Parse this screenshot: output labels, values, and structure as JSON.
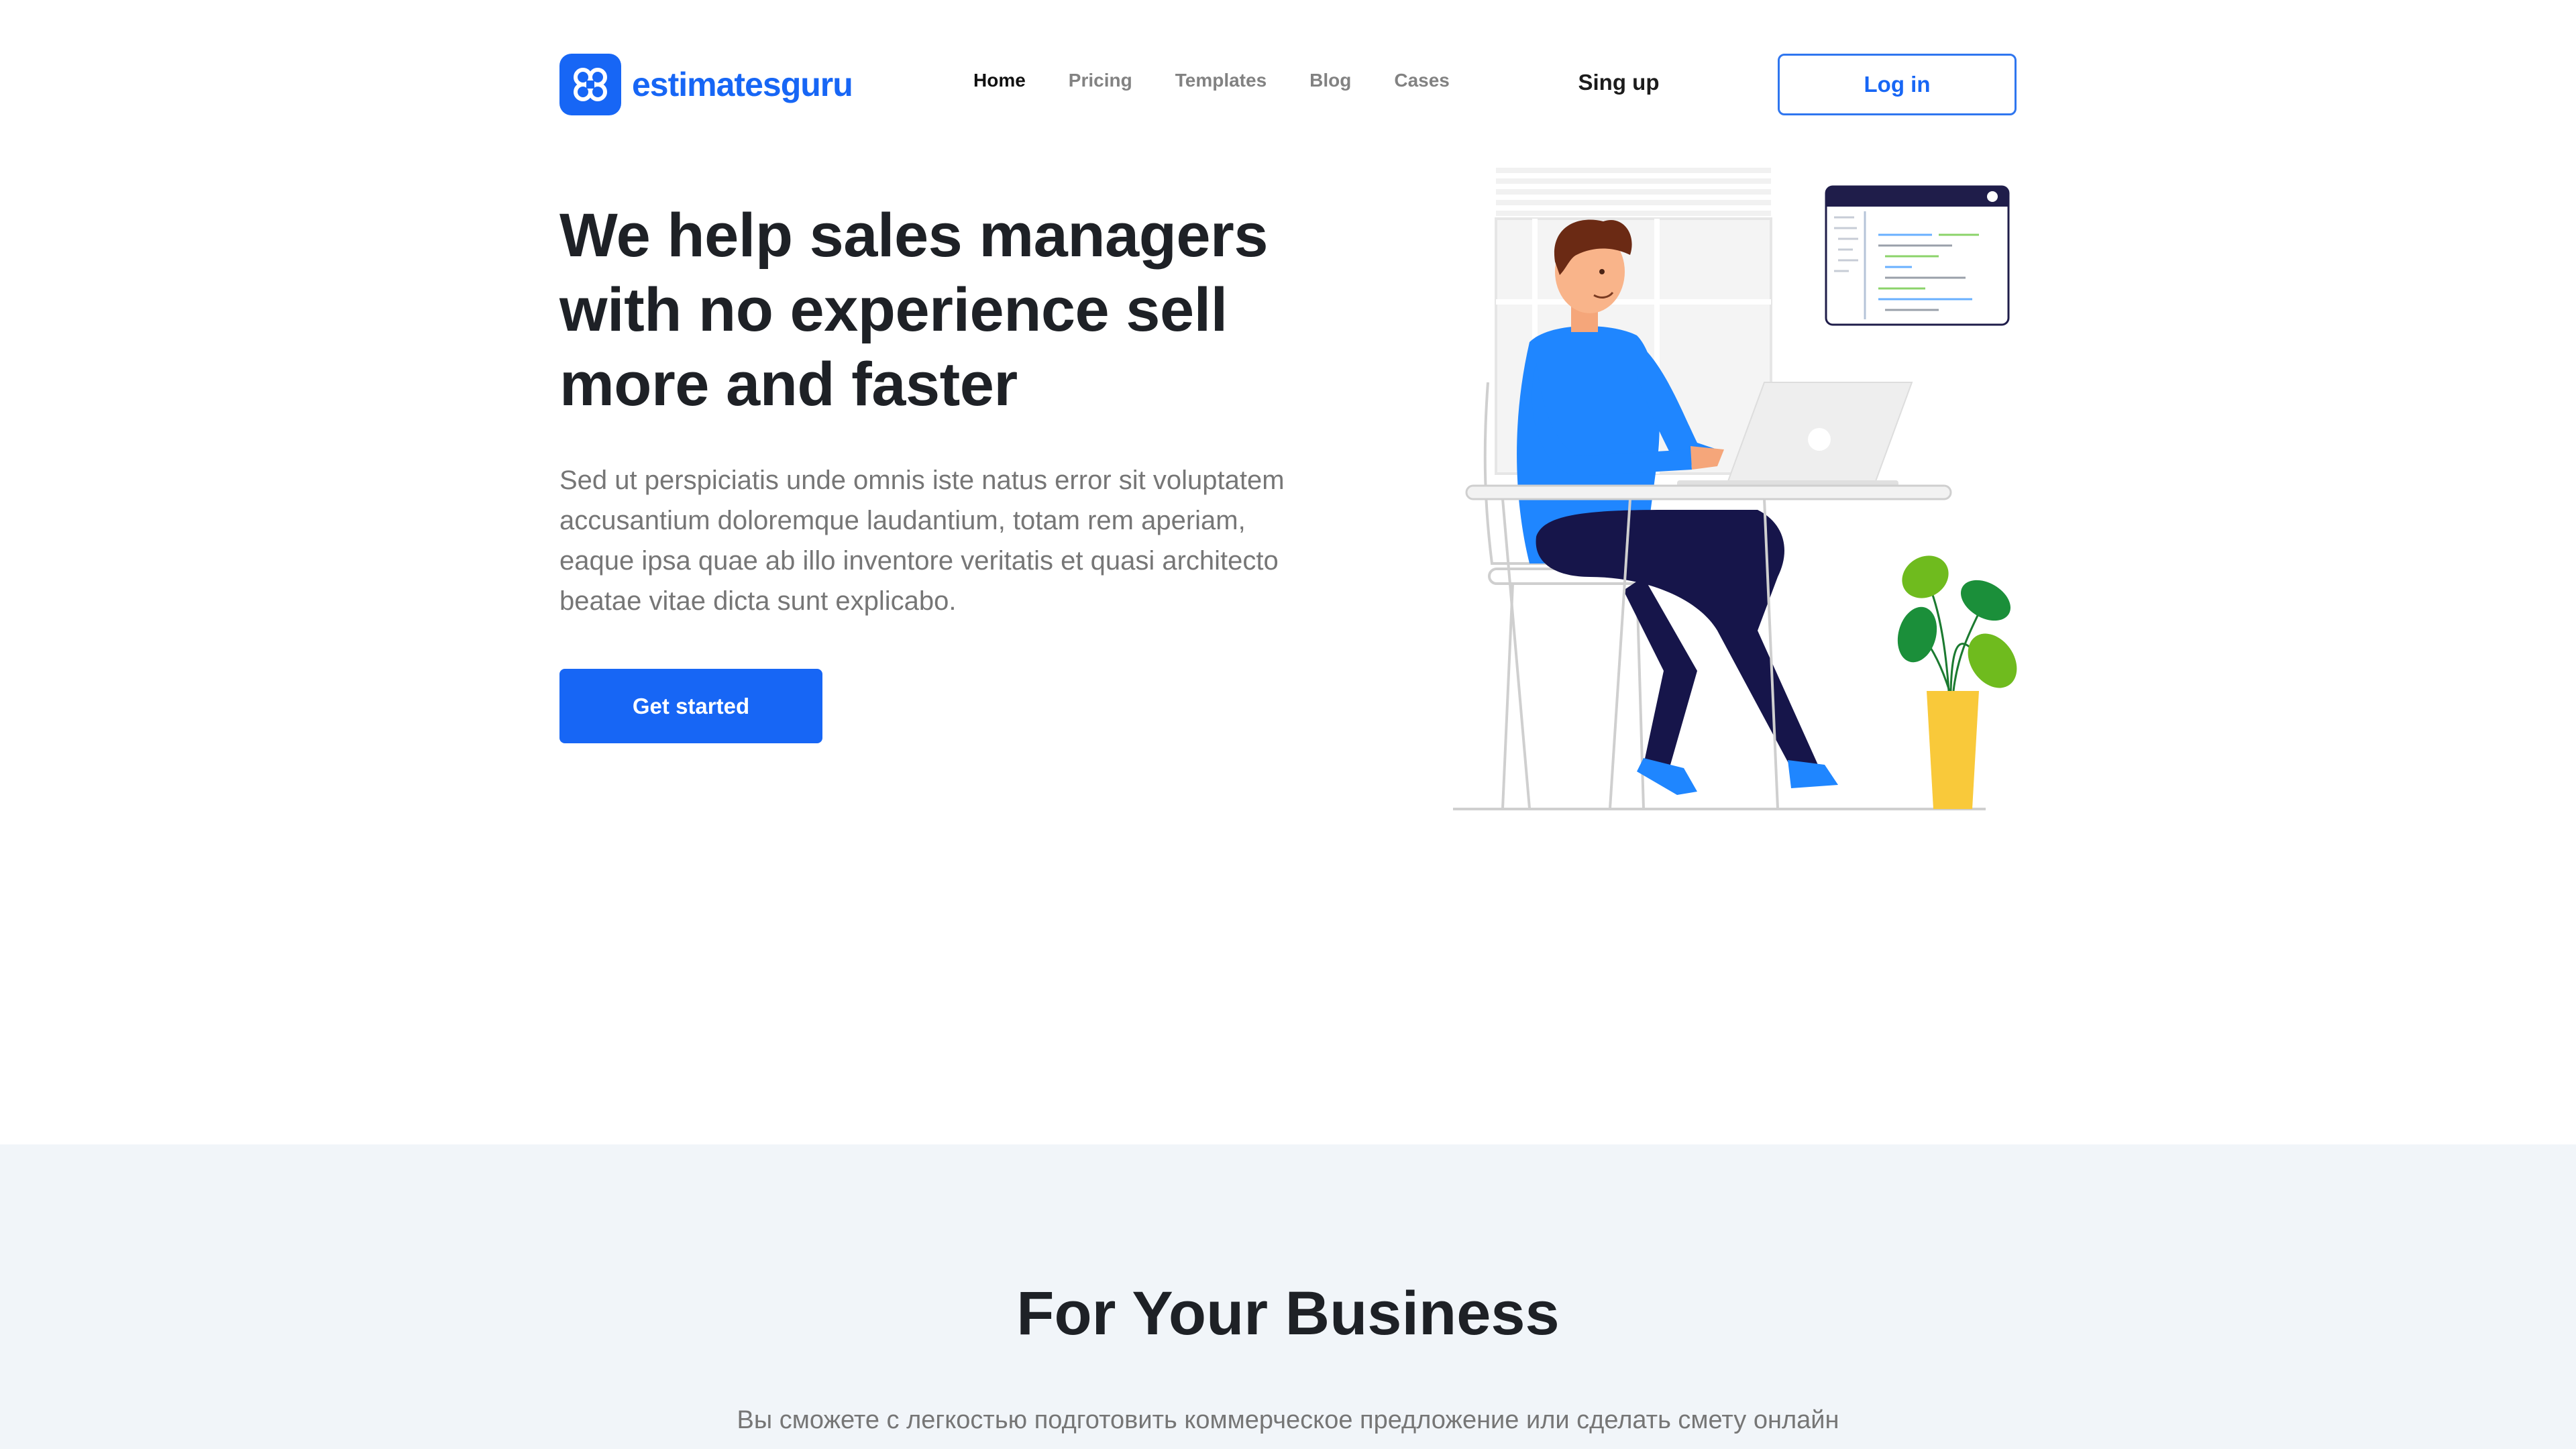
{
  "brand": {
    "name": "estimatesguru",
    "color": "#1766f5"
  },
  "nav": {
    "items": [
      "Home",
      "Pricing",
      "Templates",
      "Blog",
      "Cases"
    ],
    "active": "Home"
  },
  "auth": {
    "signup_label": "Sing up",
    "login_label": "Log in"
  },
  "hero": {
    "title": "We help sales managers with no experience sell more and faster",
    "text": "Sed ut perspiciatis unde omnis iste natus error sit voluptatem accusantium doloremque laudantium, totam rem aperiam, eaque ipsa quae ab illo inventore veritatis et quasi architecto beatae vitae dicta sunt explicabo.",
    "cta_label": "Get started"
  },
  "business": {
    "title": "For Your Business",
    "subtitle": "Вы сможете с легкостью подготовить коммерческое предложение или сделать смету онлайн"
  },
  "colors": {
    "primary": "#1766f5",
    "section_bg": "#f1f5f9",
    "text_dark": "#1e2126",
    "text_muted": "#767676",
    "pants": "#16154a",
    "plant_pot": "#f9c93a",
    "leaf": "#6fbb1e"
  },
  "icons": {
    "logo": "clover-logo-icon"
  }
}
